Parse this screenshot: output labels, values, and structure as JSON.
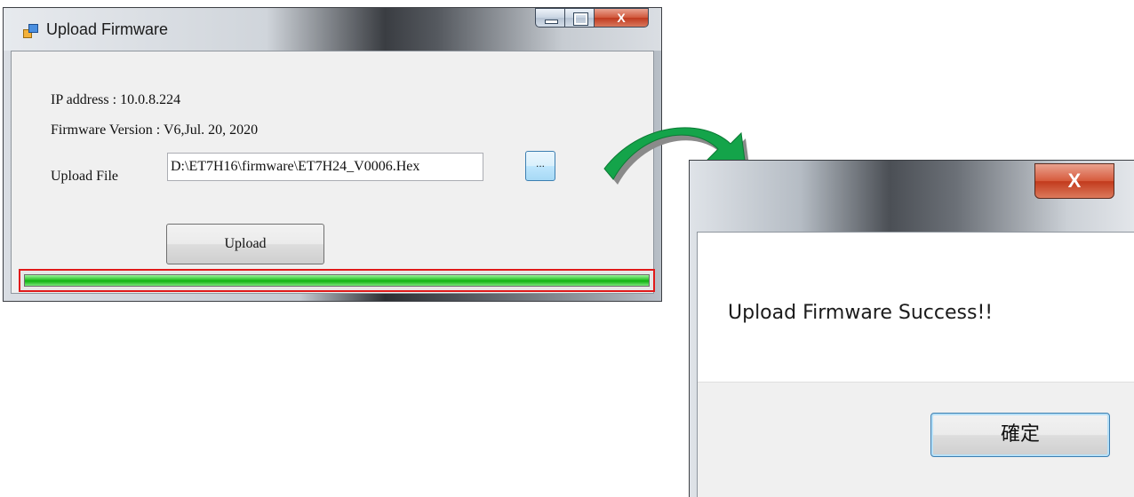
{
  "main_window": {
    "title": "Upload Firmware",
    "caption_buttons": {
      "minimize_icon": "minimize-icon",
      "maximize_icon": "maximize-icon",
      "close_glyph": "X"
    },
    "ip_label": "IP  address : 10.0.8.224",
    "firmware_label": "Firmware Version : V6,Jul. 20, 2020",
    "upload_file_label": "Upload File",
    "upload_file_value": "D:\\ET7H16\\firmware\\ET7H24_V0006.Hex",
    "browse_label": "...",
    "upload_label": "Upload",
    "progress_fraction": 1.0,
    "progress_color": "#1db81d",
    "highlight_color": "#e01a1a"
  },
  "arrow": {
    "icon": "curved-arrow-icon",
    "color": "#14a44a"
  },
  "message_box": {
    "close_glyph": "X",
    "message": "Upload Firmware Success!!",
    "ok_label": "確定"
  }
}
